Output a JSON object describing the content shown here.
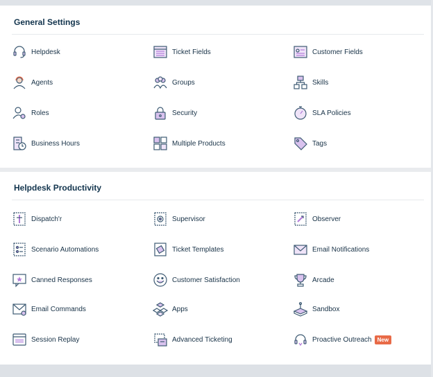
{
  "general_settings": {
    "title": "General Settings",
    "items": [
      {
        "label": "Helpdesk",
        "icon": "headset-icon"
      },
      {
        "label": "Ticket Fields",
        "icon": "ticket-fields-icon"
      },
      {
        "label": "Customer Fields",
        "icon": "customer-fields-icon"
      },
      {
        "label": "Agents",
        "icon": "agent-icon"
      },
      {
        "label": "Groups",
        "icon": "groups-icon"
      },
      {
        "label": "Skills",
        "icon": "skills-icon"
      },
      {
        "label": "Roles",
        "icon": "roles-icon"
      },
      {
        "label": "Security",
        "icon": "lock-icon"
      },
      {
        "label": "SLA Policies",
        "icon": "stopwatch-icon"
      },
      {
        "label": "Business Hours",
        "icon": "business-hours-icon"
      },
      {
        "label": "Multiple Products",
        "icon": "multiple-products-icon"
      },
      {
        "label": "Tags",
        "icon": "tags-icon"
      }
    ]
  },
  "helpdesk_productivity": {
    "title": "Helpdesk Productivity",
    "items": [
      {
        "label": "Dispatch'r",
        "icon": "dispatcher-icon"
      },
      {
        "label": "Supervisor",
        "icon": "supervisor-icon"
      },
      {
        "label": "Observer",
        "icon": "observer-icon"
      },
      {
        "label": "Scenario Automations",
        "icon": "scenario-automations-icon"
      },
      {
        "label": "Ticket Templates",
        "icon": "ticket-templates-icon"
      },
      {
        "label": "Email Notifications",
        "icon": "email-notifications-icon"
      },
      {
        "label": "Canned Responses",
        "icon": "canned-responses-icon"
      },
      {
        "label": "Customer Satisfaction",
        "icon": "smiley-icon"
      },
      {
        "label": "Arcade",
        "icon": "trophy-icon"
      },
      {
        "label": "Email Commands",
        "icon": "email-commands-icon"
      },
      {
        "label": "Apps",
        "icon": "apps-icon"
      },
      {
        "label": "Sandbox",
        "icon": "sandbox-icon"
      },
      {
        "label": "Session Replay",
        "icon": "session-replay-icon"
      },
      {
        "label": "Advanced Ticketing",
        "icon": "advanced-ticketing-icon"
      },
      {
        "label": "Proactive Outreach",
        "icon": "proactive-outreach-icon",
        "badge": "New"
      }
    ]
  },
  "colors": {
    "icon_outline": "#3d5a73",
    "icon_accent": "#b27ad9",
    "badge_bg": "#e86a47",
    "text": "#183247"
  }
}
